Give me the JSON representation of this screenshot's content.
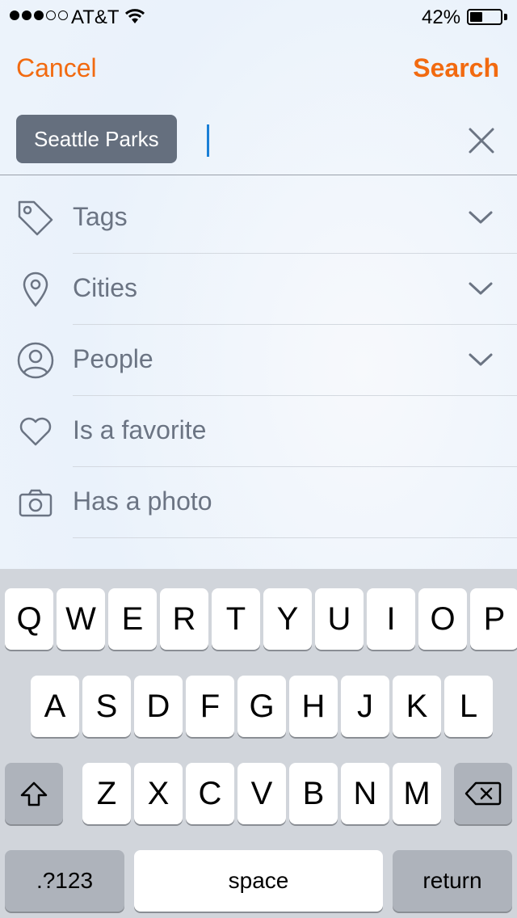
{
  "status_bar": {
    "carrier": "AT&T",
    "battery_percent": "42%",
    "battery_level": 0.42,
    "signal_bars_filled": 3,
    "signal_bars_total": 5
  },
  "nav": {
    "cancel_label": "Cancel",
    "search_label": "Search"
  },
  "search": {
    "token_label": "Seattle Parks",
    "input_value": ""
  },
  "filters": [
    {
      "label": "Tags",
      "icon": "tag-icon",
      "expandable": true
    },
    {
      "label": "Cities",
      "icon": "location-pin-icon",
      "expandable": true
    },
    {
      "label": "People",
      "icon": "person-icon",
      "expandable": true
    },
    {
      "label": "Is a favorite",
      "icon": "heart-icon",
      "expandable": false
    },
    {
      "label": "Has a photo",
      "icon": "camera-icon",
      "expandable": false
    }
  ],
  "keyboard": {
    "row1": [
      "Q",
      "W",
      "E",
      "R",
      "T",
      "Y",
      "U",
      "I",
      "O",
      "P"
    ],
    "row2": [
      "A",
      "S",
      "D",
      "F",
      "G",
      "H",
      "J",
      "K",
      "L"
    ],
    "row3": [
      "Z",
      "X",
      "C",
      "V",
      "B",
      "N",
      "M"
    ],
    "numbers_label": ".?123",
    "space_label": "space",
    "return_label": "return"
  },
  "colors": {
    "accent": "#f26a10",
    "token_bg": "#656f7e",
    "caret": "#1a7fd6",
    "label_text": "#6b7483"
  }
}
